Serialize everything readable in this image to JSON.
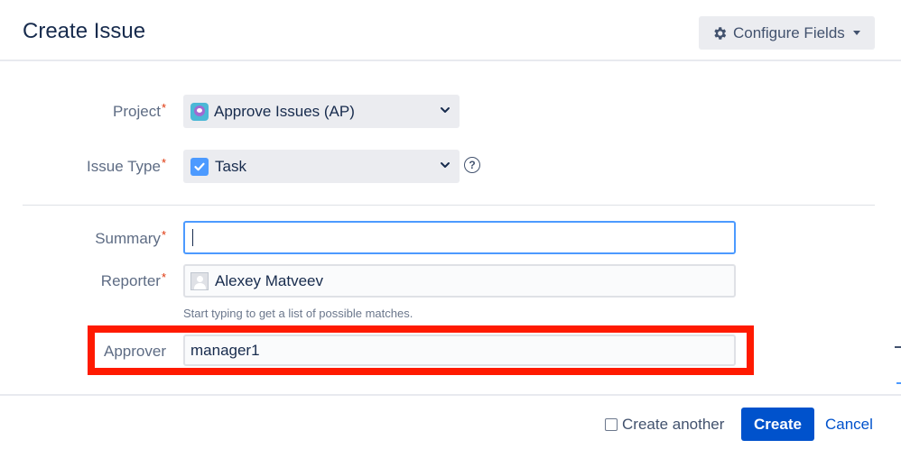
{
  "header": {
    "title": "Create Issue",
    "configure_label": "Configure Fields"
  },
  "form": {
    "project": {
      "label": "Project",
      "required": "*",
      "value": "Approve Issues (AP)"
    },
    "issue_type": {
      "label": "Issue Type",
      "required": "*",
      "value": "Task",
      "help": "?"
    },
    "summary": {
      "label": "Summary",
      "required": "*",
      "value": ""
    },
    "reporter": {
      "label": "Reporter",
      "required": "*",
      "value": "Alexey Matveev",
      "hint": "Start typing to get a list of possible matches."
    },
    "approver": {
      "label": "Approver",
      "value": "manager1"
    }
  },
  "footer": {
    "create_another_label": "Create another",
    "create_label": "Create",
    "cancel_label": "Cancel"
  },
  "colors": {
    "primary": "#0052cc",
    "required": "#de350b",
    "highlight": "#ff1a00",
    "focus": "#4c9aff"
  }
}
